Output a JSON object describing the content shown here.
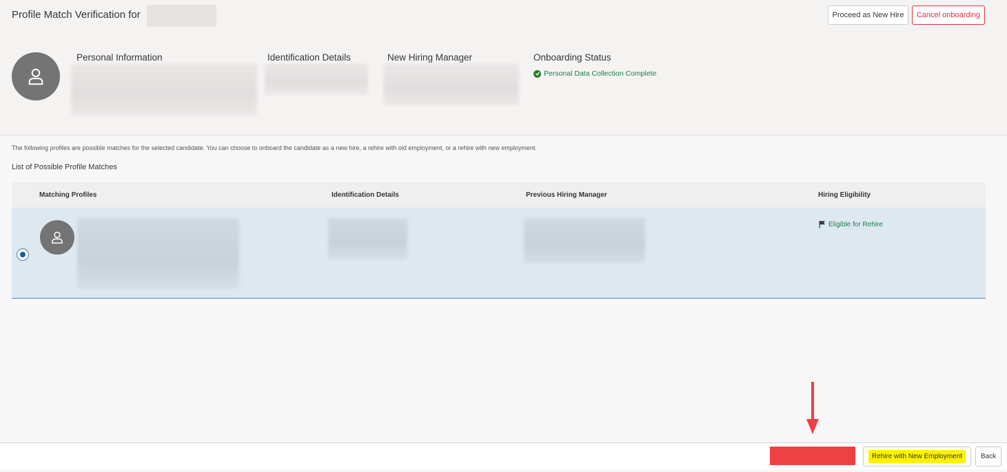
{
  "header": {
    "title": "Profile Match Verification for",
    "proceed_label": "Proceed as New Hire",
    "cancel_label": "Cancel onboarding",
    "columns": {
      "personal": "Personal Information",
      "identification": "Identification Details",
      "manager": "New Hiring Manager",
      "status": "Onboarding Status"
    },
    "status_text": "Personal Data Collection Complete"
  },
  "main": {
    "description": "The following profiles are possible matches for the selected candidate. You can choose to onboard the candidate as a new hire, a rehire with old employment, or a rehire with new employment.",
    "list_title": "List of Possible Profile Matches",
    "table": {
      "headers": [
        "Matching Profiles",
        "Identification Details",
        "Previous Hiring Manager",
        "Hiring Eligibility"
      ],
      "rows": [
        {
          "eligibility": "Eligible for Rehire",
          "selected": true
        }
      ]
    }
  },
  "footer": {
    "rehire_label": "Rehire with New Employment",
    "back_label": "Back"
  },
  "colors": {
    "accent": "#0b5ea9",
    "success": "#1a7d4c",
    "danger": "#d8303c",
    "highlight": "#fff200",
    "selected_row": "#dde8f0"
  },
  "icons": [
    "person-icon",
    "check-circle-icon",
    "flag-icon",
    "radio-selected-icon"
  ]
}
